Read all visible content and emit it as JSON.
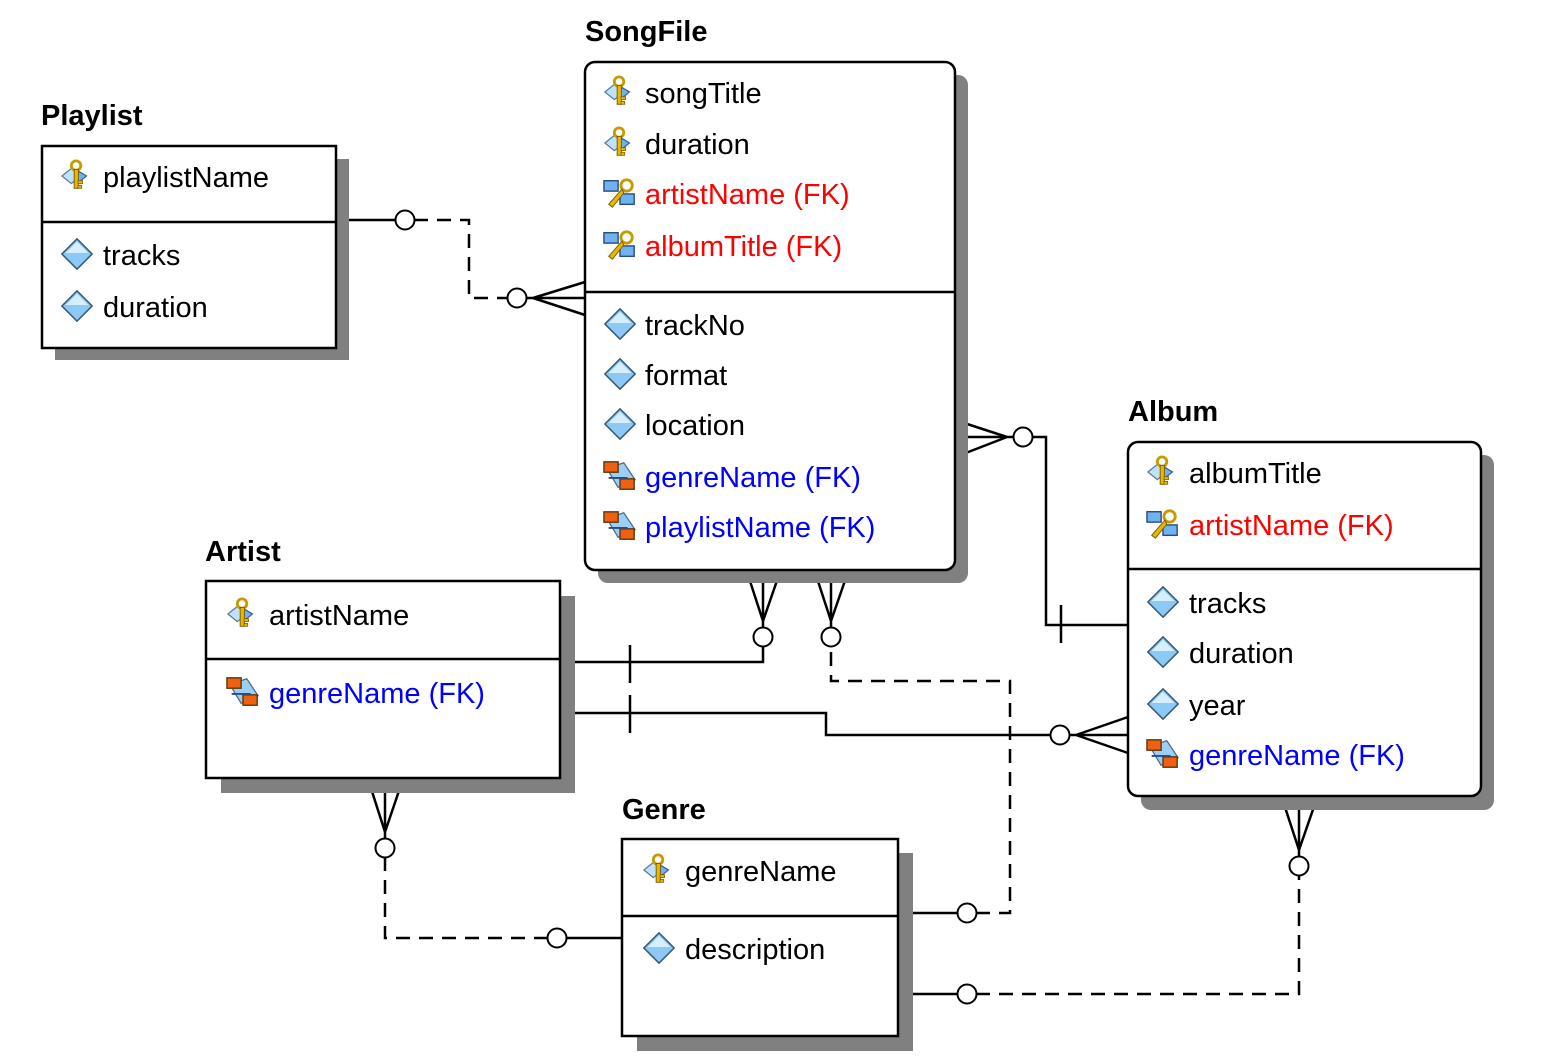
{
  "diagram": {
    "type": "entity-relationship",
    "colors": {
      "normal_text": "#000000",
      "identifying_fk_text": "#ff0000",
      "non_identifying_fk_text": "#0000ff",
      "shadow": "#808080",
      "border": "#000000"
    },
    "entities": [
      {
        "id": "playlist",
        "name": "Playlist",
        "style": "square",
        "key_attributes": [
          {
            "name": "playlistName",
            "icon": "primary-key-icon",
            "kind": "pk"
          }
        ],
        "attributes": [
          {
            "name": "tracks",
            "icon": "attribute-diamond-icon",
            "kind": "attr"
          },
          {
            "name": "duration",
            "icon": "attribute-diamond-icon",
            "kind": "attr"
          }
        ]
      },
      {
        "id": "songfile",
        "name": "SongFile",
        "style": "rounded",
        "key_attributes": [
          {
            "name": "songTitle",
            "icon": "primary-key-icon",
            "kind": "pk"
          },
          {
            "name": "duration",
            "icon": "primary-key-icon",
            "kind": "pk"
          },
          {
            "name": "artistName (FK)",
            "icon": "primary-foreign-key-icon",
            "kind": "pkfk"
          },
          {
            "name": "albumTitle (FK)",
            "icon": "primary-foreign-key-icon",
            "kind": "pkfk"
          }
        ],
        "attributes": [
          {
            "name": "trackNo",
            "icon": "attribute-diamond-icon",
            "kind": "attr"
          },
          {
            "name": "format",
            "icon": "attribute-diamond-icon",
            "kind": "attr"
          },
          {
            "name": "location",
            "icon": "attribute-diamond-icon",
            "kind": "attr"
          },
          {
            "name": "genreName (FK)",
            "icon": "foreign-key-icon",
            "kind": "fk"
          },
          {
            "name": "playlistName (FK)",
            "icon": "foreign-key-icon",
            "kind": "fk"
          }
        ]
      },
      {
        "id": "album",
        "name": "Album",
        "style": "rounded",
        "key_attributes": [
          {
            "name": "albumTitle",
            "icon": "primary-key-icon",
            "kind": "pk"
          },
          {
            "name": "artistName (FK)",
            "icon": "primary-foreign-key-icon",
            "kind": "pkfk"
          }
        ],
        "attributes": [
          {
            "name": "tracks",
            "icon": "attribute-diamond-icon",
            "kind": "attr"
          },
          {
            "name": "duration",
            "icon": "attribute-diamond-icon",
            "kind": "attr"
          },
          {
            "name": "year",
            "icon": "attribute-diamond-icon",
            "kind": "attr"
          },
          {
            "name": "genreName (FK)",
            "icon": "foreign-key-icon",
            "kind": "fk"
          }
        ]
      },
      {
        "id": "artist",
        "name": "Artist",
        "style": "square",
        "key_attributes": [
          {
            "name": "artistName",
            "icon": "primary-key-icon",
            "kind": "pk"
          }
        ],
        "attributes": [
          {
            "name": "genreName (FK)",
            "icon": "foreign-key-icon",
            "kind": "fk"
          }
        ]
      },
      {
        "id": "genre",
        "name": "Genre",
        "style": "square",
        "key_attributes": [
          {
            "name": "genreName",
            "icon": "primary-key-icon",
            "kind": "pk"
          }
        ],
        "attributes": [
          {
            "name": "description",
            "icon": "attribute-diamond-icon",
            "kind": "attr"
          }
        ]
      }
    ],
    "relationships": [
      {
        "id": "playlist-songfile",
        "parent": "Playlist",
        "child": "SongFile",
        "parent_end": "zero-or-one",
        "child_end": "zero-or-many",
        "identifying": false
      },
      {
        "id": "album-songfile",
        "parent": "Album",
        "child": "SongFile",
        "parent_end": "exactly-one",
        "child_end": "zero-or-many",
        "identifying": true
      },
      {
        "id": "artist-songfile",
        "parent": "Artist",
        "child": "SongFile",
        "parent_end": "exactly-one",
        "child_end": "zero-or-many",
        "identifying": true
      },
      {
        "id": "genre-songfile",
        "parent": "Genre",
        "child": "SongFile",
        "parent_end": "zero-or-one",
        "child_end": "zero-or-many",
        "identifying": false
      },
      {
        "id": "artist-album",
        "parent": "Artist",
        "child": "Album",
        "parent_end": "exactly-one",
        "child_end": "zero-or-many",
        "identifying": true
      },
      {
        "id": "genre-artist",
        "parent": "Genre",
        "child": "Artist",
        "parent_end": "zero-or-one",
        "child_end": "zero-or-many",
        "identifying": false
      },
      {
        "id": "genre-album",
        "parent": "Genre",
        "child": "Album",
        "parent_end": "zero-or-one",
        "child_end": "zero-or-many",
        "identifying": false
      }
    ]
  }
}
